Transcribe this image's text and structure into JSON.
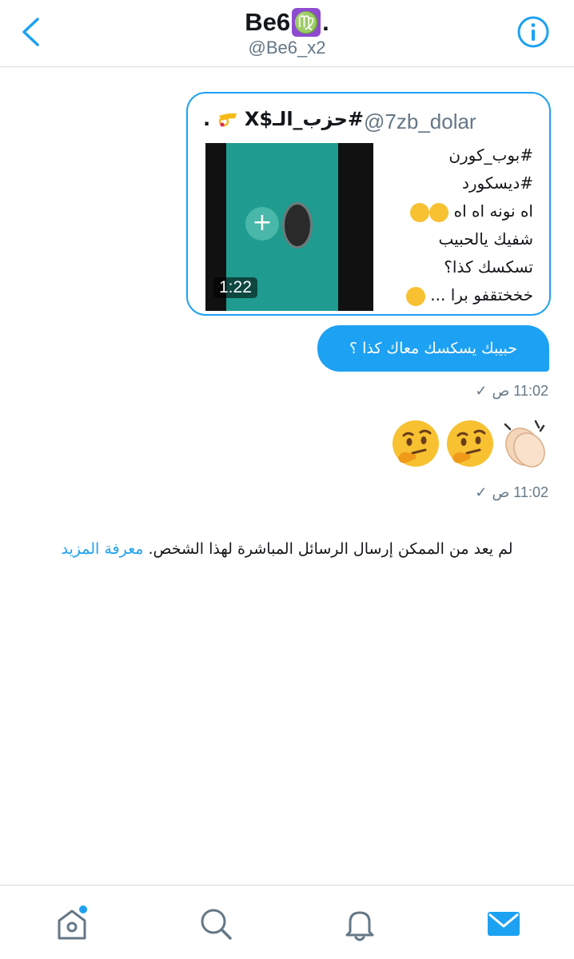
{
  "header": {
    "name": "Be6",
    "virgo_symbol": "♍",
    "name_suffix": ".",
    "handle": "@Be6_x2"
  },
  "card": {
    "name": "#حزب_الـ$X",
    "name_suffix": ".",
    "handle": "@7zb_dolar",
    "lines": [
      "#بوب_كورن",
      "#ديسكورد",
      "اه نونه اه اه",
      "شفيك يالحبيب",
      "تسكسك كذا؟",
      "خخختقفو برا ..."
    ],
    "video_duration": "1:22"
  },
  "message": {
    "text": "حبيبك يسكسك معاك كذا ؟",
    "time": "11:02 ص",
    "check": "✓"
  },
  "emoji_message": {
    "time": "11:02 ص",
    "check": "✓",
    "emojis": [
      "clapping-hands-icon",
      "thinking-face-icon",
      "thinking-face-icon"
    ]
  },
  "notice": {
    "text": "لم يعد من الممكن إرسال الرسائل المباشرة لهذا الشخص.",
    "link": "معرفة المزيد"
  },
  "colors": {
    "accent": "#1da1f2",
    "text": "#14171a",
    "muted": "#657786"
  },
  "tabs": [
    "home-icon",
    "search-icon",
    "notifications-icon",
    "messages-icon"
  ]
}
